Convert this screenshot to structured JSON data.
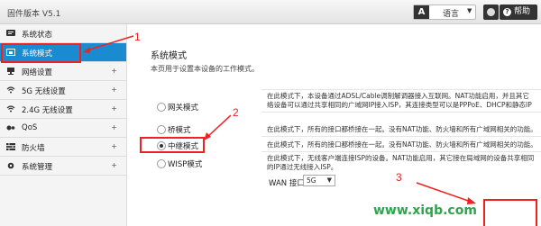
{
  "header": {
    "firmware": "固件版本 V5.1",
    "language_icon": "A",
    "language_label": "语言",
    "help_label": "帮助"
  },
  "sidebar": {
    "items": [
      {
        "label": "系统状态",
        "icon": "status-icon",
        "expand": ""
      },
      {
        "label": "系统模式",
        "icon": "mode-icon",
        "expand": ""
      },
      {
        "label": "网络设置",
        "icon": "network-icon",
        "expand": "+"
      },
      {
        "label": "5G 无线设置",
        "icon": "wifi-icon",
        "expand": "+"
      },
      {
        "label": "2.4G 无线设置",
        "icon": "wifi-icon",
        "expand": "+"
      },
      {
        "label": "QoS",
        "icon": "qos-icon",
        "expand": "+"
      },
      {
        "label": "防火墙",
        "icon": "firewall-icon",
        "expand": "+"
      },
      {
        "label": "系统管理",
        "icon": "gear-icon",
        "expand": "+"
      }
    ]
  },
  "main": {
    "title": "系统模式",
    "description": "本页用于设置本设备的工作模式。",
    "modes": [
      {
        "label": "网关模式",
        "selected": false,
        "lines": [
          "在此模式下，本设备通过ADSL/Cable调制解调器接入互联网。NAT功能启用，并且其它",
          "络设备可以通过共享相同的广域网IP接入ISP，其连接类型可以是PPPoE、DHCP和静态IP"
        ]
      },
      {
        "label": "桥模式",
        "selected": false,
        "lines": [
          "在此模式下，所有的接口都桥接在一起。没有NAT功能、防火墙和所有广域网相关的功能。"
        ]
      },
      {
        "label": "中继模式",
        "selected": true,
        "lines": [
          "在此模式下，所有的接口都桥接在一起。没有NAT功能、防火墙和所有广域网相关的功能。"
        ]
      },
      {
        "label": "WISP模式",
        "selected": false,
        "lines": [
          "在此模式下，无线客户端连接ISP的设备。NAT功能启用，其它接在局域网的设备共享相同",
          "的IP通过无线接入ISP。"
        ]
      }
    ],
    "wan_label": "WAN 接口:",
    "wan_value": "5G",
    "wan_arrow": "▼"
  },
  "annotations": {
    "n1": "1",
    "n2": "2",
    "n3": "3",
    "watermark": "www.xiqb.com",
    "color": "#e22222"
  }
}
